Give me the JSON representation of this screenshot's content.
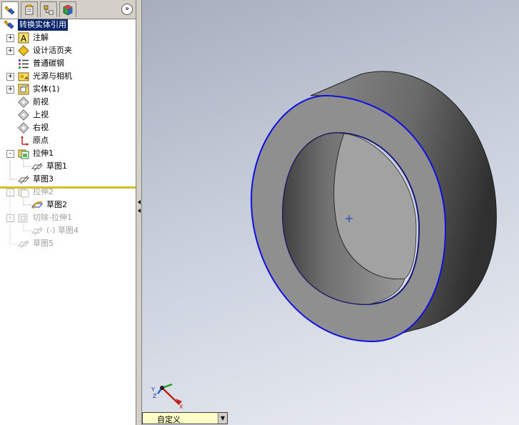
{
  "panel": {
    "tabs": [
      "feature-manager",
      "property-manager",
      "configuration-manager",
      "display-manager"
    ],
    "collapse_glyph": "»"
  },
  "tree": {
    "root": "转换实体引用",
    "items": [
      {
        "label": "注解",
        "expand": "+",
        "icon": "annotation-icon"
      },
      {
        "label": "设计活页夹",
        "expand": "+",
        "icon": "design-binder-icon"
      },
      {
        "label": "普通碳钢",
        "expand": "",
        "icon": "material-icon"
      },
      {
        "label": "光源与相机",
        "expand": "+",
        "icon": "lights-cameras-icon"
      },
      {
        "label": "实体(1)",
        "expand": "+",
        "icon": "solid-bodies-icon"
      },
      {
        "label": "前视",
        "expand": "",
        "icon": "plane-icon"
      },
      {
        "label": "上视",
        "expand": "",
        "icon": "plane-icon"
      },
      {
        "label": "右视",
        "expand": "",
        "icon": "plane-icon"
      },
      {
        "label": "原点",
        "expand": "",
        "icon": "origin-icon"
      },
      {
        "label": "拉伸1",
        "expand": "-",
        "icon": "extrude-icon"
      },
      {
        "label": "草图1",
        "expand": "",
        "icon": "sketch-icon"
      },
      {
        "label": "草图3",
        "expand": "",
        "icon": "sketch-icon"
      },
      {
        "label": "拉伸2",
        "expand": "-",
        "icon": "extrude-icon"
      },
      {
        "label": "草图2",
        "expand": "",
        "icon": "sketch-icon"
      },
      {
        "label": "切除-拉伸1",
        "expand": "-",
        "icon": "cut-extrude-icon"
      },
      {
        "label": "(-) 草图4",
        "expand": "",
        "icon": "sketch-icon"
      },
      {
        "label": "草图5",
        "expand": "",
        "icon": "sketch-icon"
      }
    ]
  },
  "triad": {
    "x": "X",
    "y": "Y",
    "z": "Z"
  },
  "view_selector": {
    "value": "自定义"
  },
  "colors": {
    "edge_highlight": "#1010e0",
    "rollback_bar": "#d4c020"
  }
}
